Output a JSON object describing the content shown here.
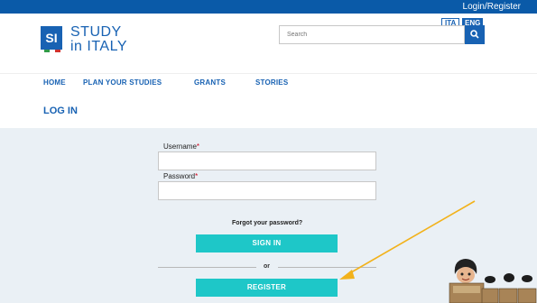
{
  "topbar": {
    "login_register": "Login/Register"
  },
  "logo": {
    "mark": "SI",
    "line1": "STUDY",
    "line2": "in ITALY"
  },
  "languages": {
    "ita": "ITA",
    "eng": "ENG"
  },
  "search": {
    "placeholder": "Search"
  },
  "nav": {
    "home": "HOME",
    "plan": "PLAN YOUR STUDIES",
    "grants": "GRANTS",
    "stories": "STORIES"
  },
  "page": {
    "title": "LOG IN"
  },
  "form": {
    "username_label": "Username",
    "password_label": "Password",
    "required_mark": "*",
    "forgot_password": "Forgot your password?",
    "sign_in": "SIGN IN",
    "or": "or",
    "register": "REGISTER"
  },
  "colors": {
    "brand_blue": "#1862b3",
    "topbar_blue": "#0a5aa8",
    "button_teal": "#1ec7c8",
    "form_bg": "#eaf0f5",
    "arrow": "#f2b21b"
  },
  "icons": {
    "search": "magnifier-icon",
    "annotation": "arrow-icon"
  }
}
